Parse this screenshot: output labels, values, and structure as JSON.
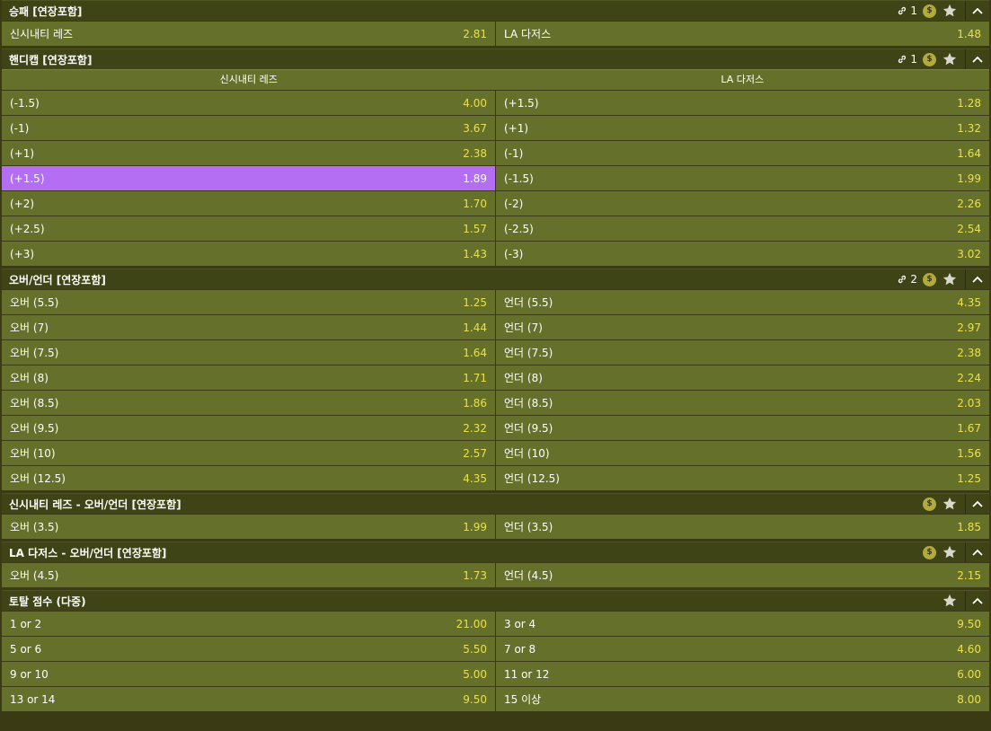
{
  "markets": [
    {
      "title": "승패 [연장포함]",
      "link_count": "1",
      "coin": "$",
      "rows": [
        [
          {
            "label": "신시내티 레즈",
            "odds": "2.81"
          },
          {
            "label": "LA 다저스",
            "odds": "1.48"
          }
        ]
      ]
    },
    {
      "title": "핸디캡 [연장포함]",
      "link_count": "1",
      "coin": "$",
      "columns": [
        "신시내티 레즈",
        "LA 다저스"
      ],
      "rows": [
        [
          {
            "label": "(-1.5)",
            "odds": "4.00"
          },
          {
            "label": "(+1.5)",
            "odds": "1.28"
          }
        ],
        [
          {
            "label": "(-1)",
            "odds": "3.67"
          },
          {
            "label": "(+1)",
            "odds": "1.32"
          }
        ],
        [
          {
            "label": "(+1)",
            "odds": "2.38"
          },
          {
            "label": "(-1)",
            "odds": "1.64"
          }
        ],
        [
          {
            "label": "(+1.5)",
            "odds": "1.89",
            "selected": true
          },
          {
            "label": "(-1.5)",
            "odds": "1.99"
          }
        ],
        [
          {
            "label": "(+2)",
            "odds": "1.70"
          },
          {
            "label": "(-2)",
            "odds": "2.26"
          }
        ],
        [
          {
            "label": "(+2.5)",
            "odds": "1.57"
          },
          {
            "label": "(-2.5)",
            "odds": "2.54"
          }
        ],
        [
          {
            "label": "(+3)",
            "odds": "1.43"
          },
          {
            "label": "(-3)",
            "odds": "3.02"
          }
        ]
      ]
    },
    {
      "title": "오버/언더 [연장포함]",
      "link_count": "2",
      "coin": "$",
      "rows": [
        [
          {
            "label": "오버 (5.5)",
            "odds": "1.25"
          },
          {
            "label": "언더 (5.5)",
            "odds": "4.35"
          }
        ],
        [
          {
            "label": "오버 (7)",
            "odds": "1.44"
          },
          {
            "label": "언더 (7)",
            "odds": "2.97"
          }
        ],
        [
          {
            "label": "오버 (7.5)",
            "odds": "1.64"
          },
          {
            "label": "언더 (7.5)",
            "odds": "2.38"
          }
        ],
        [
          {
            "label": "오버 (8)",
            "odds": "1.71"
          },
          {
            "label": "언더 (8)",
            "odds": "2.24"
          }
        ],
        [
          {
            "label": "오버 (8.5)",
            "odds": "1.86"
          },
          {
            "label": "언더 (8.5)",
            "odds": "2.03"
          }
        ],
        [
          {
            "label": "오버 (9.5)",
            "odds": "2.32"
          },
          {
            "label": "언더 (9.5)",
            "odds": "1.67"
          }
        ],
        [
          {
            "label": "오버 (10)",
            "odds": "2.57"
          },
          {
            "label": "언더 (10)",
            "odds": "1.56"
          }
        ],
        [
          {
            "label": "오버 (12.5)",
            "odds": "4.35"
          },
          {
            "label": "언더 (12.5)",
            "odds": "1.25"
          }
        ]
      ]
    },
    {
      "title": "신시내티 레즈 - 오버/언더 [연장포함]",
      "coin": "$",
      "rows": [
        [
          {
            "label": "오버 (3.5)",
            "odds": "1.99"
          },
          {
            "label": "언더 (3.5)",
            "odds": "1.85"
          }
        ]
      ]
    },
    {
      "title": "LA 다저스 - 오버/언더 [연장포함]",
      "coin": "$",
      "rows": [
        [
          {
            "label": "오버 (4.5)",
            "odds": "1.73"
          },
          {
            "label": "언더 (4.5)",
            "odds": "2.15"
          }
        ]
      ]
    },
    {
      "title": "토탈 점수 (다중)",
      "rows": [
        [
          {
            "label": "1 or 2",
            "odds": "21.00"
          },
          {
            "label": "3 or 4",
            "odds": "9.50"
          }
        ],
        [
          {
            "label": "5 or 6",
            "odds": "5.50"
          },
          {
            "label": "7 or 8",
            "odds": "4.60"
          }
        ],
        [
          {
            "label": "9 or 10",
            "odds": "5.00"
          },
          {
            "label": "11 or 12",
            "odds": "6.00"
          }
        ],
        [
          {
            "label": "13 or 14",
            "odds": "9.50"
          },
          {
            "label": "15 이상",
            "odds": "8.00"
          }
        ]
      ]
    }
  ],
  "colors": {
    "background": "#3a3a14",
    "header": "#3f4416",
    "cell": "#65712a",
    "odds_text": "#e8e052",
    "selected": "#b46ef3",
    "coin": "#b3aa3a"
  },
  "icons": {
    "link": "link-icon",
    "coin": "coin-icon",
    "favorite": "star-icon",
    "collapse": "chevron-up-icon"
  }
}
